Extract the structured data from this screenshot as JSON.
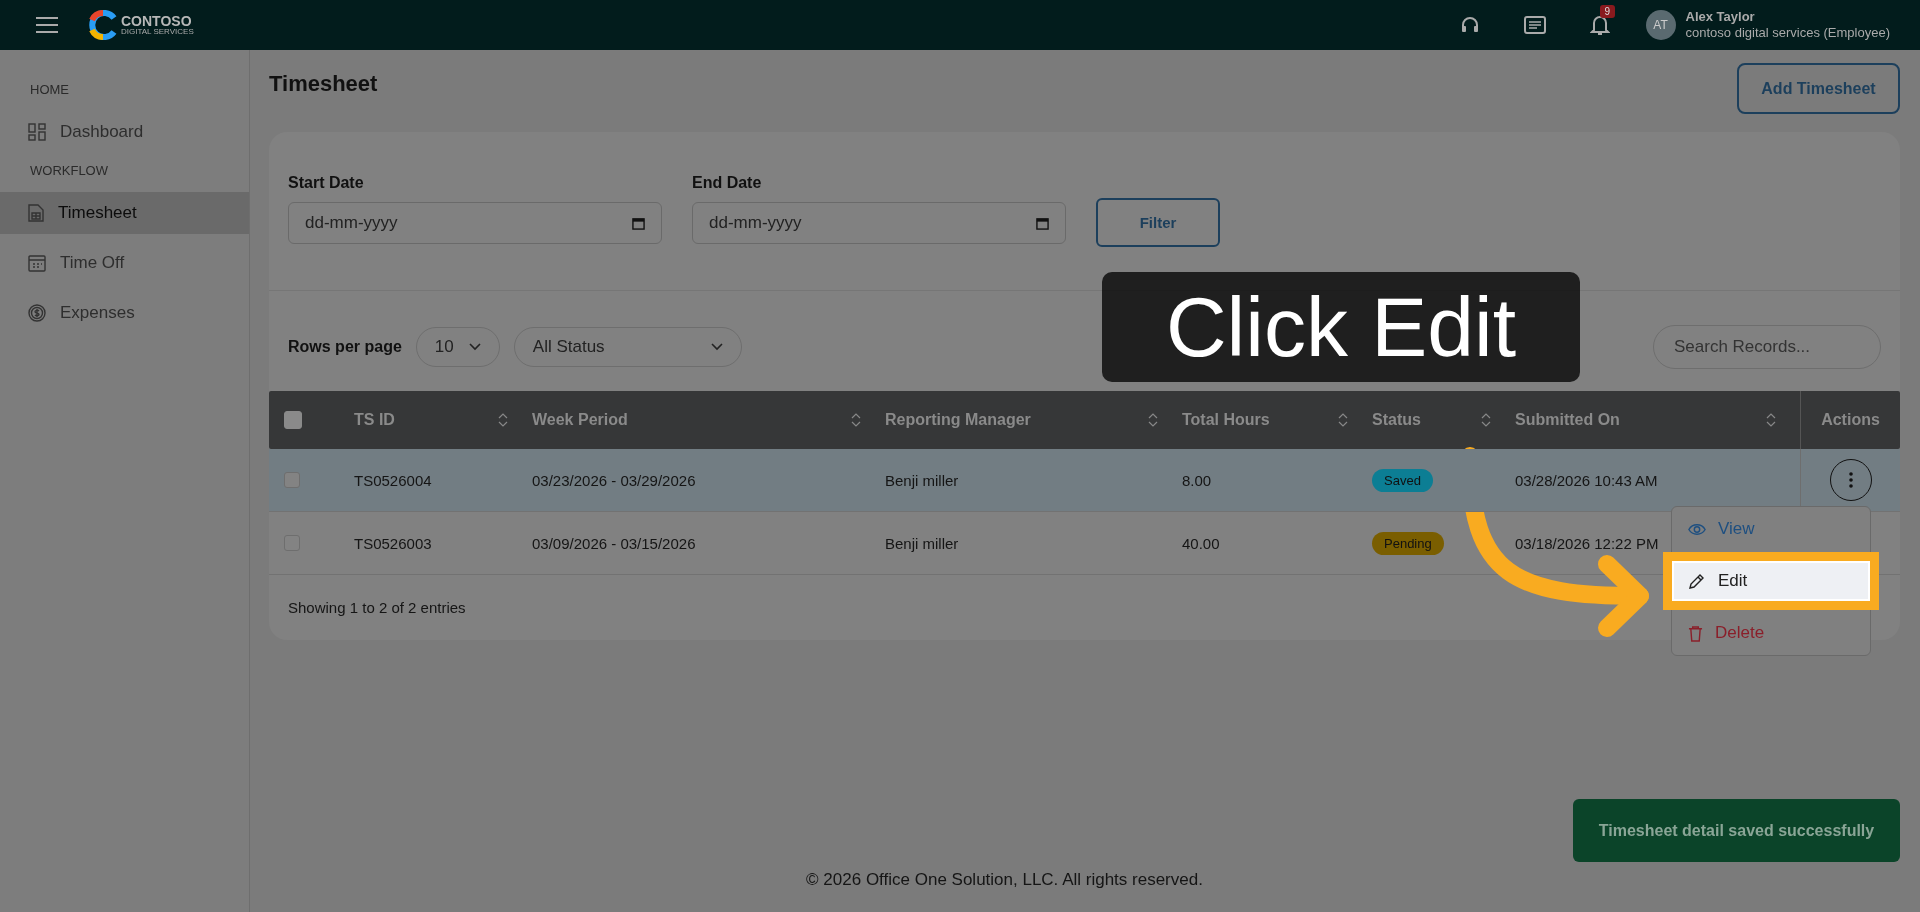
{
  "topbar": {
    "logo": {
      "name": "CONTOSO",
      "tagline": "DIGITAL SERVICES"
    },
    "notification_count": "9",
    "user": {
      "initials": "AT",
      "name": "Alex Taylor",
      "org": "contoso digital services (Employee)"
    }
  },
  "sidebar": {
    "sections": [
      {
        "title": "HOME",
        "items": [
          {
            "label": "Dashboard",
            "kind": "grid",
            "selected": false
          }
        ]
      },
      {
        "title": "WORKFLOW",
        "items": [
          {
            "label": "Timesheet",
            "kind": "sheet",
            "selected": true
          },
          {
            "label": "Time Off",
            "kind": "calendar",
            "selected": false
          },
          {
            "label": "Expenses",
            "kind": "coin",
            "selected": false
          }
        ]
      }
    ]
  },
  "page": {
    "title": "Timesheet",
    "add_button": "Add Timesheet"
  },
  "filters": {
    "start": {
      "label": "Start Date",
      "placeholder": "dd-mm-yyyy"
    },
    "end": {
      "label": "End Date",
      "placeholder": "dd-mm-yyyy"
    },
    "button": "Filter"
  },
  "controls": {
    "rows_label": "Rows per page",
    "rows_value": "10",
    "status_value": "All Status",
    "search_placeholder": "Search Records..."
  },
  "table": {
    "select_all_checked": false,
    "columns": [
      {
        "label": "TS ID",
        "sortable": true
      },
      {
        "label": "Week Period",
        "sortable": true
      },
      {
        "label": "Reporting Manager",
        "sortable": true
      },
      {
        "label": "Total Hours",
        "sortable": true
      },
      {
        "label": "Status",
        "sortable": true
      },
      {
        "label": "Submitted On",
        "sortable": true
      },
      {
        "label": "Actions",
        "sortable": false
      }
    ],
    "rows": [
      {
        "checked": false,
        "highlighted": true,
        "id": "TS0526004",
        "period": "03/23/2026 - 03/29/2026",
        "manager": "Benji miller",
        "hours": "8.00",
        "status": {
          "label": "Saved",
          "color": "#0c7e94"
        },
        "submitted": "03/28/2026 10:43 AM",
        "menu_open": true
      },
      {
        "checked": false,
        "highlighted": false,
        "id": "TS0526003",
        "period": "03/09/2026 - 03/15/2026",
        "manager": "Benji miller",
        "hours": "40.00",
        "status": {
          "label": "Pending",
          "color": "#7a5e00"
        },
        "submitted": "03/18/2026 12:22 PM",
        "menu_open": false
      }
    ],
    "footer": "Showing 1 to 2 of 2 entries"
  },
  "row_menu": [
    {
      "label": "View",
      "kind": "view",
      "highlighted": false
    },
    {
      "label": "Edit",
      "kind": "edit",
      "highlighted": true
    },
    {
      "label": "Delete",
      "kind": "delete",
      "highlighted": false
    }
  ],
  "guide": {
    "caption": "Click Edit"
  },
  "toast": "Timesheet detail saved successfully",
  "copyright": "© 2026 Office One Solution, LLC. All rights reserved."
}
